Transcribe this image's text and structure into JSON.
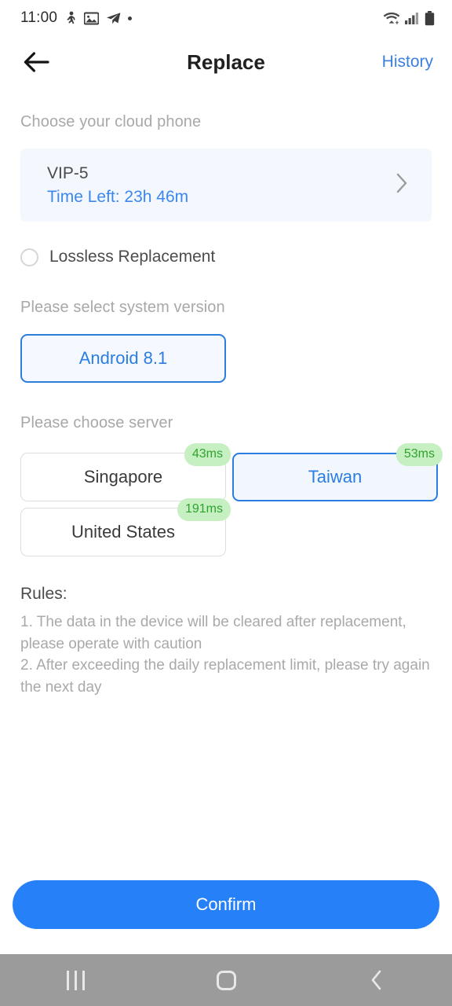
{
  "statusbar": {
    "time": "11:00",
    "left_icons": [
      "person-walking-icon",
      "image-icon",
      "telegram-icon",
      "dot-icon"
    ],
    "right_icons": [
      "wifi-icon",
      "signal-bars-icon",
      "battery-icon"
    ]
  },
  "header": {
    "back_icon": "arrow-left-icon",
    "title": "Replace",
    "history_label": "History"
  },
  "cloud_phone": {
    "section_label": "Choose your cloud phone",
    "name": "VIP-5",
    "time_left": "Time Left: 23h 46m",
    "chevron_icon": "chevron-right-icon"
  },
  "lossless": {
    "label": "Lossless Replacement",
    "checked": false
  },
  "system_version": {
    "section_label": "Please select system version",
    "options": [
      {
        "label": "Android 8.1",
        "selected": true
      }
    ]
  },
  "server": {
    "section_label": "Please choose server",
    "options": [
      {
        "label": "Singapore",
        "ping": "43ms",
        "selected": false
      },
      {
        "label": "Taiwan",
        "ping": "53ms",
        "selected": true
      },
      {
        "label": "United States",
        "ping": "191ms",
        "selected": false
      }
    ]
  },
  "rules": {
    "title": "Rules:",
    "body": "1. The data in the device will be cleared after replacement, please operate with caution\n2. After exceeding the daily replacement limit, please try again the next day"
  },
  "footer": {
    "confirm_label": "Confirm"
  },
  "navbar": {
    "recents_icon": "recents-icon",
    "home_icon": "home-icon",
    "back_icon": "nav-back-icon"
  },
  "colors": {
    "accent_blue": "#2680f8",
    "link_blue": "#3b7fe0",
    "card_bg": "#f4f8fe",
    "badge_green_bg": "#c6f0c1",
    "badge_green_text": "#30a230",
    "navbar_gray": "#9b9b9b"
  }
}
